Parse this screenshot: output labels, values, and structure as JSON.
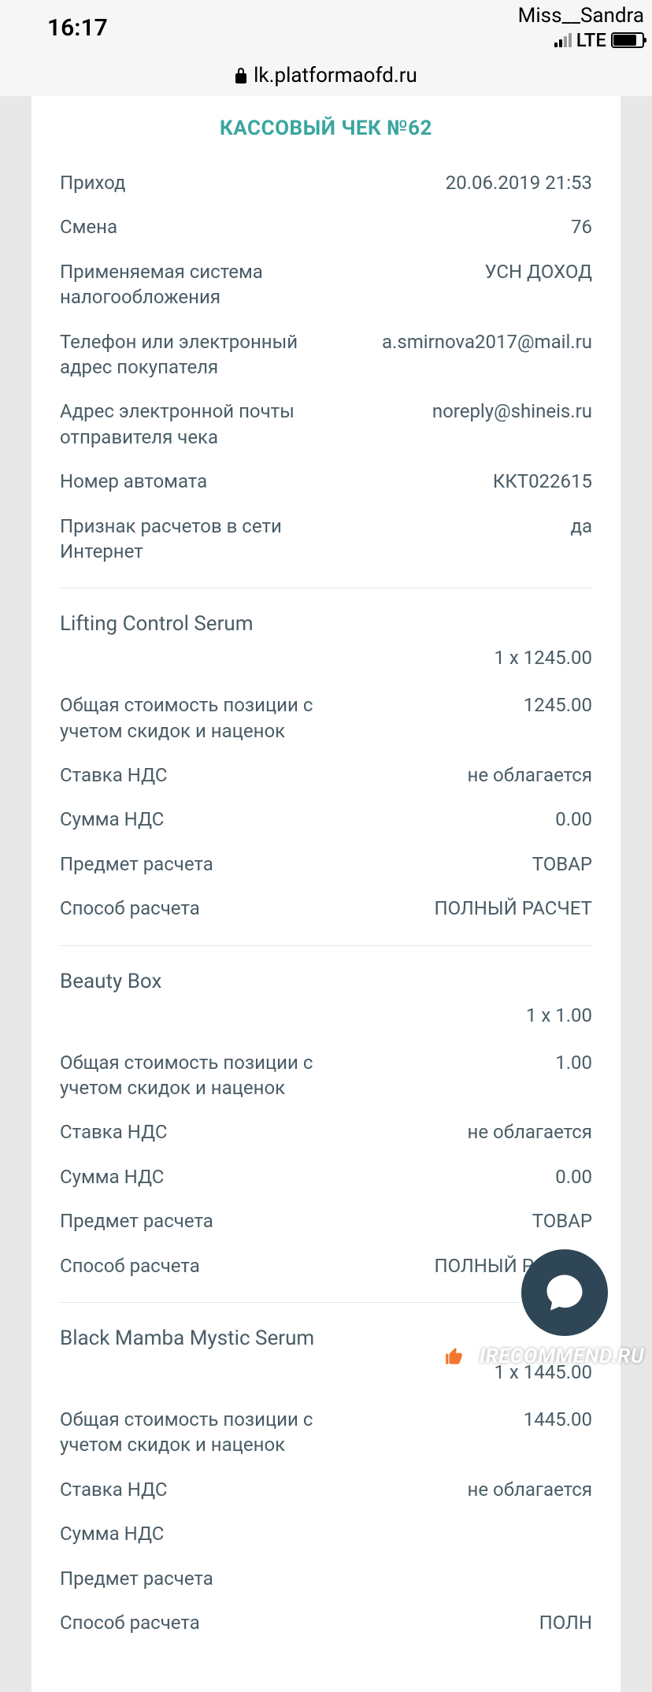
{
  "status": {
    "time": "16:17",
    "name": "Miss__Sandra",
    "network": "LTE"
  },
  "url": "lk.platformaofd.ru",
  "receipt": {
    "title": "КАССОВЫЙ ЧЕК №62",
    "header_rows": [
      {
        "label": "Приход",
        "value": "20.06.2019 21:53"
      },
      {
        "label": "Смена",
        "value": "76"
      },
      {
        "label": "Применяемая система налогообложения",
        "value": "УСН ДОХОД"
      },
      {
        "label": "Телефон или электронный адрес покупателя",
        "value": "a.smirnova2017@mail.ru"
      },
      {
        "label": "Адрес электронной почты отправителя чека",
        "value": "noreply@shineis.ru"
      },
      {
        "label": "Номер автомата",
        "value": "ККТ022615"
      },
      {
        "label": "Признак расчетов в сети Интернет",
        "value": "да"
      }
    ],
    "items": [
      {
        "name": "Lifting Control Serum",
        "qty_price": "1 x 1245.00",
        "rows": [
          {
            "label": "Общая стоимость позиции с учетом скидок и наценок",
            "value": "1245.00"
          },
          {
            "label": "Ставка НДС",
            "value": "не облагается"
          },
          {
            "label": "Сумма НДС",
            "value": "0.00"
          },
          {
            "label": "Предмет расчета",
            "value": "ТОВАР"
          },
          {
            "label": "Способ расчета",
            "value": "ПОЛНЫЙ РАСЧЕТ"
          }
        ]
      },
      {
        "name": "Beauty Box",
        "qty_price": "1 x 1.00",
        "rows": [
          {
            "label": "Общая стоимость позиции с учетом скидок и наценок",
            "value": "1.00"
          },
          {
            "label": "Ставка НДС",
            "value": "не облагается"
          },
          {
            "label": "Сумма НДС",
            "value": "0.00"
          },
          {
            "label": "Предмет расчета",
            "value": "ТОВАР"
          },
          {
            "label": "Способ расчета",
            "value": "ПОЛНЫЙ РАСЧЕТ"
          }
        ]
      },
      {
        "name": "Black Mamba Mystic Serum",
        "qty_price": "1 x 1445.00",
        "rows": [
          {
            "label": "Общая стоимость позиции с учетом скидок и наценок",
            "value": "1445.00"
          },
          {
            "label": "Ставка НДС",
            "value": "не облагается"
          },
          {
            "label": "Сумма НДС",
            "value": ""
          },
          {
            "label": "Предмет расчета",
            "value": ""
          },
          {
            "label": "Способ расчета",
            "value": "ПОЛН"
          }
        ]
      }
    ]
  },
  "watermark": "IRECOMMEND.RU"
}
